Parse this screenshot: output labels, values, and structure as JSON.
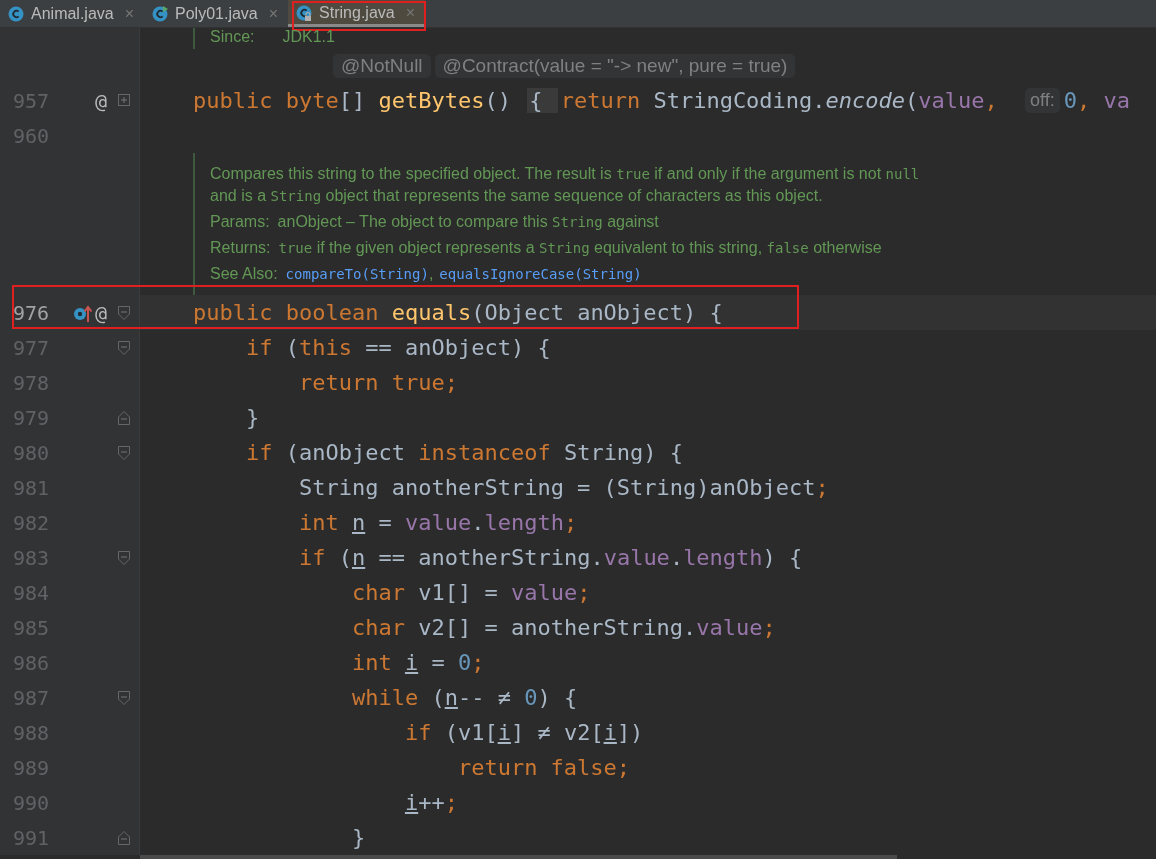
{
  "tabs": [
    {
      "label": "Animal.java",
      "kind": "class",
      "close": "×",
      "selected": false,
      "marked": false
    },
    {
      "label": "Poly01.java",
      "kind": "runnable",
      "close": "×",
      "selected": false,
      "marked": false
    },
    {
      "label": "String.java",
      "kind": "locked",
      "close": "×",
      "selected": true,
      "marked": true
    }
  ],
  "doc_tail": {
    "label": "Since:",
    "text": "JDK1.1"
  },
  "inlay_hints": [
    "@NotNull",
    "@Contract(value = \"-> new\", pure = true)"
  ],
  "lines_before": [
    {
      "number": "957",
      "gutter": [
        {
          "kind": "text",
          "text": "@"
        }
      ],
      "fold": {
        "kind": "plus"
      },
      "current": false,
      "marked": false,
      "tokens": [
        {
          "kind": "kw",
          "t": "public byte"
        },
        {
          "kind": "p",
          "t": "[] "
        },
        {
          "kind": "fn",
          "t": "getBytes"
        },
        {
          "kind": "p",
          "t": "() "
        },
        {
          "kind": "fold",
          "t": "{ "
        },
        {
          "kind": "kw",
          "t": "return"
        },
        {
          "kind": "p",
          "t": " StringCoding."
        },
        {
          "kind": "it",
          "t": "encode"
        },
        {
          "kind": "p",
          "t": "("
        },
        {
          "kind": "field",
          "t": "value"
        },
        {
          "kind": "kw",
          "t": ", "
        },
        {
          "kind": "hint",
          "t": "off:"
        },
        {
          "kind": "num",
          "t": "0"
        },
        {
          "kind": "kw",
          "t": ", "
        },
        {
          "kind": "field",
          "t": "va"
        }
      ]
    },
    {
      "number": "960",
      "current": false,
      "marked": false
    }
  ],
  "doc": {
    "rows": [
      {
        "segments": [
          {
            "t": "Compares this string to the specified object. The result is "
          },
          {
            "t": "true",
            "code": true
          },
          {
            "t": " if and only if the argument is not "
          },
          {
            "t": "null",
            "code": true
          },
          {
            "t": " and is a "
          },
          {
            "t": "String",
            "code": true
          },
          {
            "t": " object that represents the same sequence of characters as this object."
          }
        ]
      },
      {
        "label": "Params:",
        "segments": [
          {
            "t": "anObject – The object to compare this "
          },
          {
            "t": "String",
            "code": true
          },
          {
            "t": " against"
          }
        ]
      },
      {
        "label": "Returns:",
        "segments": [
          {
            "t": "true",
            "code": true
          },
          {
            "t": " if the given object represents a "
          },
          {
            "t": "String",
            "code": true
          },
          {
            "t": " equivalent to this string, "
          },
          {
            "t": "false",
            "code": true
          },
          {
            "t": " otherwise"
          }
        ]
      },
      {
        "label": "See Also:",
        "links": [
          "compareTo(String)",
          "equalsIgnoreCase(String)"
        ],
        "separator": ","
      }
    ]
  },
  "lines": [
    {
      "number": "976",
      "gutter": [
        {
          "kind": "overrides"
        },
        {
          "kind": "text",
          "text": "@"
        }
      ],
      "fold": {
        "kind": "open"
      },
      "current": true,
      "marked": true,
      "tokens": [
        {
          "kind": "kw",
          "t": "public boolean "
        },
        {
          "kind": "fn",
          "t": "equals"
        },
        {
          "kind": "p",
          "t": "(Object anObject) {"
        }
      ]
    },
    {
      "number": "977",
      "fold": {
        "kind": "open"
      },
      "current": false,
      "marked": false,
      "tokens": [
        {
          "kind": "kw",
          "t": "    if"
        },
        {
          "kind": "p",
          "t": " ("
        },
        {
          "kind": "kw",
          "t": "this"
        },
        {
          "kind": "p",
          "t": " == anObject) {"
        }
      ]
    },
    {
      "number": "978",
      "current": false,
      "marked": false,
      "tokens": [
        {
          "kind": "kw",
          "t": "        return true;"
        }
      ]
    },
    {
      "number": "979",
      "fold": {
        "kind": "close"
      },
      "current": false,
      "marked": false,
      "tokens": [
        {
          "kind": "p",
          "t": "    }"
        }
      ]
    },
    {
      "number": "980",
      "fold": {
        "kind": "open"
      },
      "current": false,
      "marked": false,
      "tokens": [
        {
          "kind": "kw",
          "t": "    if"
        },
        {
          "kind": "p",
          "t": " (anObject "
        },
        {
          "kind": "kw",
          "t": "instanceof"
        },
        {
          "kind": "p",
          "t": " String) {"
        }
      ]
    },
    {
      "number": "981",
      "current": false,
      "marked": false,
      "tokens": [
        {
          "kind": "p",
          "t": "        String anotherString = (String)anObject"
        },
        {
          "kind": "kw",
          "t": ";"
        }
      ]
    },
    {
      "number": "982",
      "current": false,
      "marked": false,
      "tokens": [
        {
          "kind": "kw",
          "t": "        int "
        },
        {
          "kind": "var",
          "t": "n"
        },
        {
          "kind": "p",
          "t": " = "
        },
        {
          "kind": "field",
          "t": "value"
        },
        {
          "kind": "p",
          "t": "."
        },
        {
          "kind": "field",
          "t": "length"
        },
        {
          "kind": "kw",
          "t": ";"
        }
      ]
    },
    {
      "number": "983",
      "fold": {
        "kind": "open"
      },
      "current": false,
      "marked": false,
      "tokens": [
        {
          "kind": "kw",
          "t": "        if"
        },
        {
          "kind": "p",
          "t": " ("
        },
        {
          "kind": "var",
          "t": "n"
        },
        {
          "kind": "p",
          "t": " == anotherString."
        },
        {
          "kind": "field",
          "t": "value"
        },
        {
          "kind": "p",
          "t": "."
        },
        {
          "kind": "field",
          "t": "length"
        },
        {
          "kind": "p",
          "t": ") {"
        }
      ]
    },
    {
      "number": "984",
      "current": false,
      "marked": false,
      "tokens": [
        {
          "kind": "kw",
          "t": "            char "
        },
        {
          "kind": "p",
          "t": "v1[] = "
        },
        {
          "kind": "field",
          "t": "value"
        },
        {
          "kind": "kw",
          "t": ";"
        }
      ]
    },
    {
      "number": "985",
      "current": false,
      "marked": false,
      "tokens": [
        {
          "kind": "kw",
          "t": "            char "
        },
        {
          "kind": "p",
          "t": "v2[] = anotherString."
        },
        {
          "kind": "field",
          "t": "value"
        },
        {
          "kind": "kw",
          "t": ";"
        }
      ]
    },
    {
      "number": "986",
      "current": false,
      "marked": false,
      "tokens": [
        {
          "kind": "kw",
          "t": "            int "
        },
        {
          "kind": "var",
          "t": "i"
        },
        {
          "kind": "p",
          "t": " = "
        },
        {
          "kind": "num",
          "t": "0"
        },
        {
          "kind": "kw",
          "t": ";"
        }
      ]
    },
    {
      "number": "987",
      "fold": {
        "kind": "open"
      },
      "current": false,
      "marked": false,
      "tokens": [
        {
          "kind": "kw",
          "t": "            while"
        },
        {
          "kind": "p",
          "t": " ("
        },
        {
          "kind": "var",
          "t": "n"
        },
        {
          "kind": "p",
          "t": "-- ≠ "
        },
        {
          "kind": "num",
          "t": "0"
        },
        {
          "kind": "p",
          "t": ") {"
        }
      ]
    },
    {
      "number": "988",
      "current": false,
      "marked": false,
      "tokens": [
        {
          "kind": "kw",
          "t": "                if"
        },
        {
          "kind": "p",
          "t": " (v1["
        },
        {
          "kind": "var",
          "t": "i"
        },
        {
          "kind": "p",
          "t": "] ≠ v2["
        },
        {
          "kind": "var",
          "t": "i"
        },
        {
          "kind": "p",
          "t": "])"
        }
      ]
    },
    {
      "number": "989",
      "current": false,
      "marked": false,
      "tokens": [
        {
          "kind": "kw",
          "t": "                    return false;"
        }
      ]
    },
    {
      "number": "990",
      "current": false,
      "marked": false,
      "tokens": [
        {
          "kind": "var",
          "t": "                i"
        },
        {
          "kind": "p",
          "t": "++"
        },
        {
          "kind": "kw",
          "t": ";"
        }
      ]
    },
    {
      "number": "991",
      "fold": {
        "kind": "close"
      },
      "current": false,
      "marked": false,
      "tokens": [
        {
          "kind": "p",
          "t": "            }"
        }
      ]
    }
  ]
}
